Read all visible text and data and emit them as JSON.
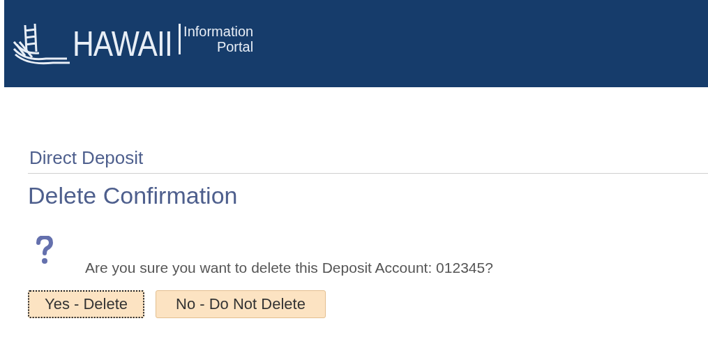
{
  "header": {
    "logo_word": "HAWAII",
    "logo_sub_top": "Information",
    "logo_sub_bottom": "Portal"
  },
  "breadcrumb": "Direct Deposit",
  "title": "Delete Confirmation",
  "message": "Are you sure you want to delete this Deposit Account: 012345?",
  "buttons": [
    {
      "label": "Yes - Delete",
      "focused": true
    },
    {
      "label": "No - Do Not Delete",
      "focused": false
    }
  ]
}
